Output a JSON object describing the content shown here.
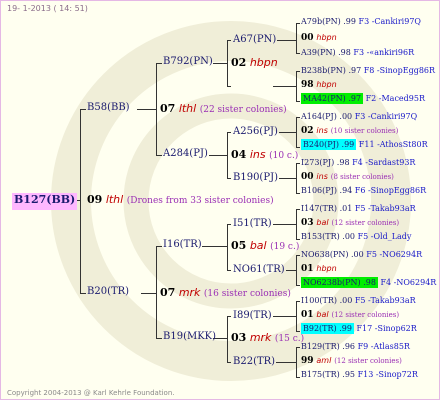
{
  "header": "19-  1-2013 ( 14: 51)",
  "footer": "Copyright 2004-2013 @ Karl Kehrle Foundation.",
  "colors": {
    "root_bg": "#ffb7ff",
    "green": "#00ee00",
    "cyan": "#00ffff"
  },
  "root": {
    "name": "B127(BB)",
    "year": "09",
    "breed": "lthl",
    "note": "(Drones from 33 sister colonies)"
  },
  "gen1": [
    {
      "name": "B58(BB)",
      "year": "07",
      "breed": "lthl",
      "note": "(22 sister colonies)"
    },
    {
      "name": "B20(TR)",
      "year": "07",
      "breed": "mrk",
      "note": "(16 sister colonies)"
    }
  ],
  "gen2": [
    {
      "name": "B792(PN)",
      "year": "02",
      "breed": "hbpn",
      "note": ""
    },
    {
      "name": "A284(PJ)",
      "year": "04",
      "breed": "ins",
      "note": "(10 c.)"
    },
    {
      "name": "I16(TR)",
      "year": "05",
      "breed": "bal",
      "note": "(19 c.)"
    },
    {
      "name": "B19(MKK)",
      "year": "03",
      "breed": "mrk",
      "note": "(15 c.)"
    }
  ],
  "gen3": [
    "A67(PN)",
    "A256(PJ)",
    "B190(PJ)",
    "I51(TR)",
    "NO61(TR)",
    "I89(TR)",
    "B22(TR)"
  ],
  "gen4": [
    {
      "mother": "A79b(PN) .99",
      "code": "F3 -Cankiri97Q",
      "year": "00",
      "breed": "hbpn",
      "note": "",
      "father": "A39(PN) .98",
      "fcode": "F3 -«ankiri96R"
    },
    {
      "mother": "B238b(PN) .97",
      "code": "F8 -SinopEgg86R",
      "year": "98",
      "breed": "hbpn",
      "note": "",
      "father": "MA42(PN) .97",
      "fcode": "F2 -Maced95R"
    },
    {
      "mother": "A164(PJ) .00",
      "code": "F3 -Cankiri97Q",
      "year": "02",
      "breed": "ins",
      "note": "(10 sister colonies)",
      "father": "B240(PJ) .99",
      "fcode": "F11 -AthosSt80R"
    },
    {
      "mother": "I273(PJ) .98",
      "code": "F4 -Sardast93R",
      "year": "00",
      "breed": "ins",
      "note": "(8 sister colonies)",
      "father": "B106(PJ) .94",
      "fcode": "F6 -SinopEgg86R"
    },
    {
      "mother": "I147(TR) .01",
      "code": "F5 -Takab93aR",
      "year": "03",
      "breed": "bal",
      "note": "(12 sister colonies)",
      "father": "B153(TR) .00",
      "fcode": "F5 -Old_Lady"
    },
    {
      "mother": "NO638(PN) .00",
      "code": "F5 -NO6294R",
      "year": "01",
      "breed": "hbpn",
      "note": "",
      "father": "NO6238b(PN) .98",
      "fcode": "F4 -NO6294R"
    },
    {
      "mother": "I100(TR) .00",
      "code": "F5 -Takab93aR",
      "year": "01",
      "breed": "bal",
      "note": "(12 sister colonies)",
      "father": "B92(TR) .99",
      "fcode": "F17 -Sinop62R"
    },
    {
      "mother": "B129(TR) .96",
      "code": "F9 -Atlas85R",
      "year": "99",
      "breed": "aml",
      "note": "(12 sister colonies)",
      "father": "B175(TR) .95",
      "fcode": "F13 -Sinop72R"
    }
  ]
}
